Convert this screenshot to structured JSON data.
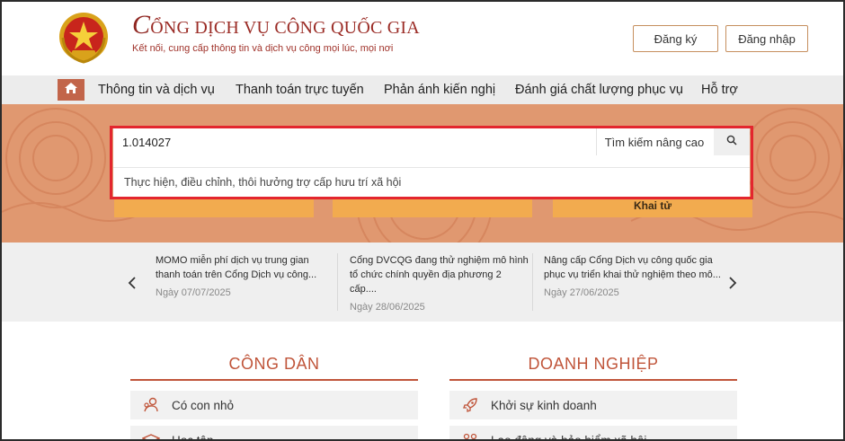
{
  "header": {
    "title_first_letter": "C",
    "title_rest": "ỔNG DỊCH VỤ CÔNG QUỐC GIA",
    "subtitle": "Kết nối, cung cấp thông tin và dịch vụ công mọi lúc, mọi nơi",
    "register_label": "Đăng ký",
    "login_label": "Đăng nhập"
  },
  "nav": {
    "items": [
      {
        "label": "Thông tin và dịch vụ"
      },
      {
        "label": "Thanh toán trực tuyến"
      },
      {
        "label": "Phản ánh kiến nghị"
      },
      {
        "label": "Đánh giá chất lượng phục vụ"
      },
      {
        "label": "Hỗ trợ"
      }
    ]
  },
  "search": {
    "value": "1.014027",
    "advanced_label": "Tìm kiếm nâng cao",
    "suggestion": "Thực hiện, điều chỉnh, thôi hưởng trợ cấp hưu trí xã hội"
  },
  "tiles": [
    {
      "label": ""
    },
    {
      "label": ""
    },
    {
      "label": "Khai tử"
    }
  ],
  "news": [
    {
      "title": "MOMO miễn phí dịch vụ trung gian thanh toán trên Cổng Dịch vụ công...",
      "date": "Ngày 07/07/2025"
    },
    {
      "title": "Cổng DVCQG đang thử nghiệm mô hình tổ chức chính quyền địa phương 2 cấp....",
      "date": "Ngày 28/06/2025"
    },
    {
      "title": "Nâng cấp Cổng Dịch vụ công quốc gia phục vụ triển khai thử nghiệm theo mô...",
      "date": "Ngày 27/06/2025"
    }
  ],
  "sections": {
    "citizen": {
      "title": "CÔNG DÂN",
      "items": [
        {
          "label": "Có con nhỏ"
        },
        {
          "label": "Học tập"
        }
      ]
    },
    "business": {
      "title": "DOANH NGHIỆP",
      "items": [
        {
          "label": "Khởi sự kinh doanh"
        },
        {
          "label": "Lao động và bảo hiểm xã hội"
        }
      ]
    }
  },
  "colors": {
    "accent": "#c0553a",
    "brand": "#9b2c26",
    "hero": "#e09870",
    "tile": "#f2ab4f",
    "highlight": "#e3262e"
  },
  "icons": [
    "national-emblem",
    "home-icon",
    "search-icon",
    "chevron-left-icon",
    "chevron-right-icon",
    "baby-icon",
    "graduation-cap-icon",
    "rocket-icon",
    "workers-icon"
  ]
}
